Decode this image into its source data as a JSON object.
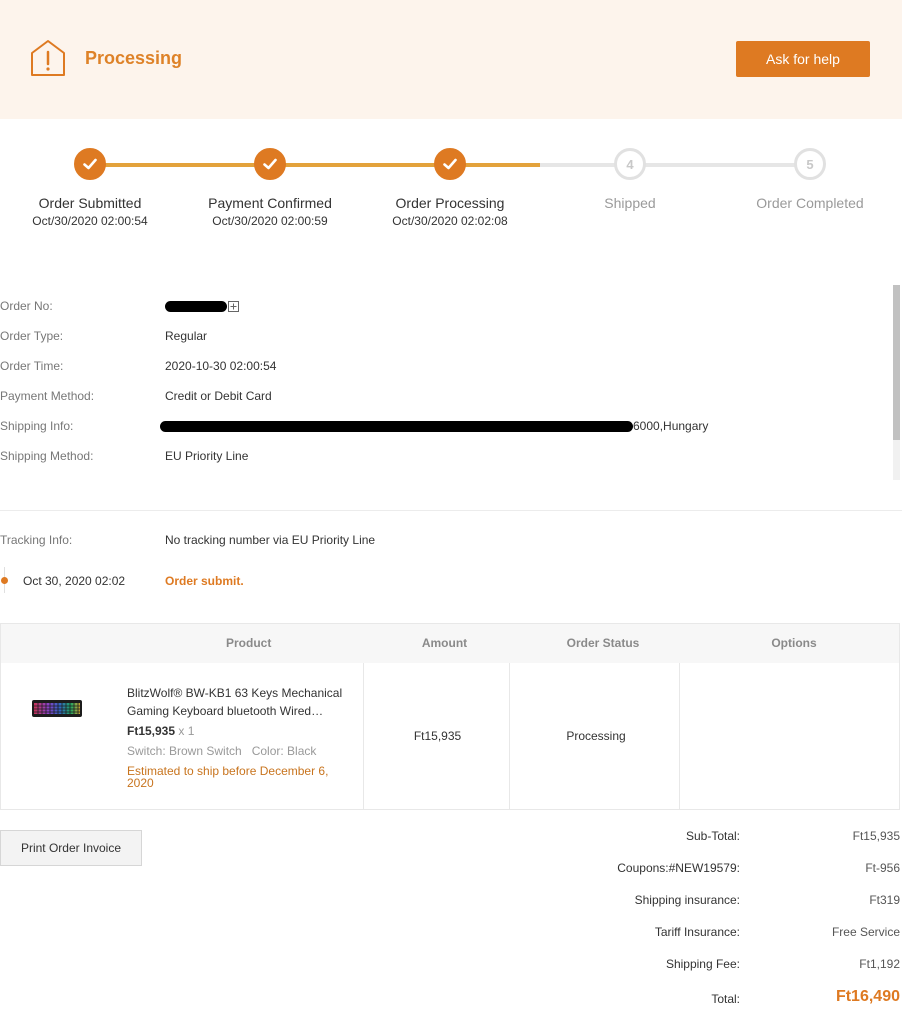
{
  "banner": {
    "status": "Processing",
    "help_button": "Ask for help",
    "colors": {
      "accent": "#de7a22",
      "background": "#fdf4ec"
    }
  },
  "steps": [
    {
      "number": "1",
      "label": "Order Submitted",
      "time": "Oct/30/2020 02:00:54",
      "done": true
    },
    {
      "number": "2",
      "label": "Payment Confirmed",
      "time": "Oct/30/2020 02:00:59",
      "done": true
    },
    {
      "number": "3",
      "label": "Order Processing",
      "time": "Oct/30/2020 02:02:08",
      "done": true
    },
    {
      "number": "4",
      "label": "Shipped",
      "time": "",
      "done": false
    },
    {
      "number": "5",
      "label": "Order Completed",
      "time": "",
      "done": false
    }
  ],
  "order_info": {
    "order_no_label": "Order No:",
    "order_type_label": "Order Type:",
    "order_type": "Regular",
    "order_time_label": "Order Time:",
    "order_time": "2020-10-30 02:00:54",
    "payment_method_label": "Payment Method:",
    "payment_method": "Credit or Debit Card",
    "shipping_info_label": "Shipping Info:",
    "shipping_info_visible": "6000,Hungary",
    "shipping_method_label": "Shipping Method:",
    "shipping_method": "EU Priority Line"
  },
  "tracking": {
    "label": "Tracking Info:",
    "value": "No tracking number via EU Priority Line",
    "events": [
      {
        "time": "Oct 30, 2020 02:02",
        "description": "Order submit."
      }
    ]
  },
  "table": {
    "headers": {
      "product": "Product",
      "amount": "Amount",
      "status": "Order Status",
      "options": "Options"
    },
    "rows": [
      {
        "name": "BlitzWolf® BW-KB1 63 Keys Mechanical Gaming Keyboard bluetooth Wired…",
        "price": "Ft15,935",
        "quantity": "x 1",
        "attributes": "Switch: Brown Switch   Color: Black",
        "ship_estimate": "Estimated to ship before December 6, 2020",
        "amount": "Ft15,935",
        "status": "Processing"
      }
    ]
  },
  "invoice_button": "Print Order Invoice",
  "summary": {
    "subtotal_label": "Sub-Total:",
    "subtotal": "Ft15,935",
    "coupon_label": "Coupons:#NEW19579:",
    "coupon": "Ft-956",
    "insurance_label": "Shipping insurance:",
    "insurance": "Ft319",
    "tariff_label": "Tariff Insurance:",
    "tariff": "Free Service",
    "shipping_label": "Shipping Fee:",
    "shipping": "Ft1,192",
    "total_label": "Total:",
    "total": "Ft16,490"
  }
}
